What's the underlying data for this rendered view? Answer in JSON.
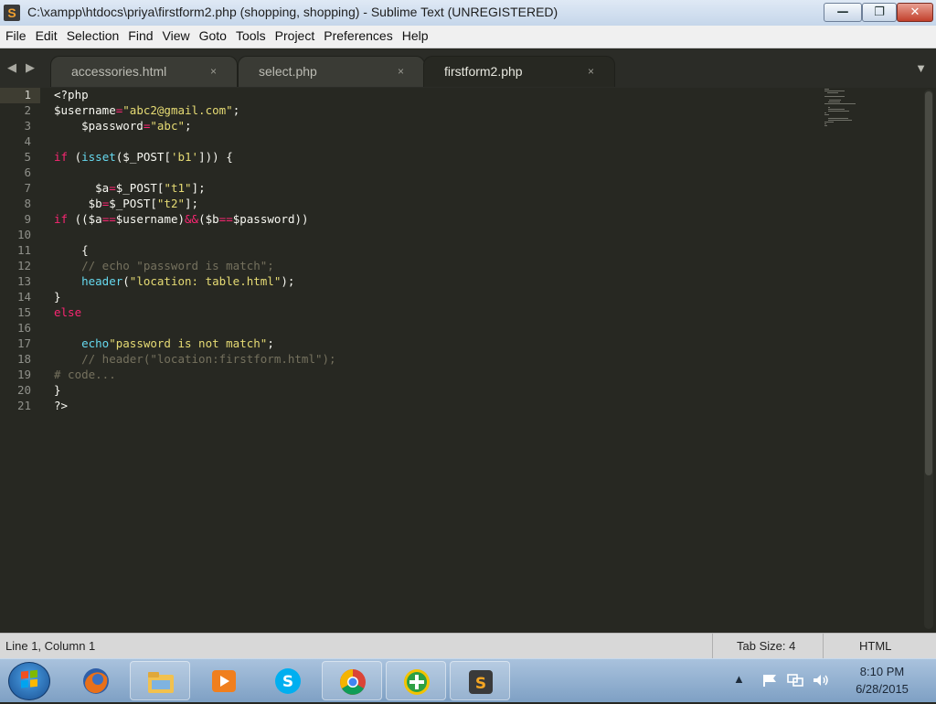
{
  "window": {
    "title": "C:\\xampp\\htdocs\\priya\\firstform2.php (shopping, shopping) - Sublime Text (UNREGISTERED)",
    "app_icon_letter": "S",
    "min_label": "—",
    "max_label": "❐",
    "close_label": "✕"
  },
  "menu": [
    "File",
    "Edit",
    "Selection",
    "Find",
    "View",
    "Goto",
    "Tools",
    "Project",
    "Preferences",
    "Help"
  ],
  "tabs": [
    {
      "label": "accessories.html",
      "close": "×",
      "active": false
    },
    {
      "label": "select.php",
      "close": "×",
      "active": false
    },
    {
      "label": "firstform2.php",
      "close": "×",
      "active": true
    }
  ],
  "nav": {
    "back": "◀",
    "forward": "▶",
    "dropdown": "▼"
  },
  "editor": {
    "current_line": 1,
    "lines": [
      [
        {
          "t": "<?php"
        }
      ],
      [
        {
          "t": "$username"
        },
        {
          "t": "=",
          "c": "o"
        },
        {
          "t": "\"abc2@gmail.com\"",
          "c": "s"
        },
        {
          "t": ";"
        }
      ],
      [
        {
          "t": "    $password"
        },
        {
          "t": "=",
          "c": "o"
        },
        {
          "t": "\"abc\"",
          "c": "s"
        },
        {
          "t": ";"
        }
      ],
      [
        {
          "t": ""
        }
      ],
      [
        {
          "t": "if",
          "c": "k"
        },
        {
          "t": " ("
        },
        {
          "t": "isset",
          "c": "f"
        },
        {
          "t": "($_POST["
        },
        {
          "t": "'b1'",
          "c": "s"
        },
        {
          "t": "])) {"
        }
      ],
      [
        {
          "t": ""
        }
      ],
      [
        {
          "t": "      $a"
        },
        {
          "t": "=",
          "c": "o"
        },
        {
          "t": "$_POST["
        },
        {
          "t": "\"t1\"",
          "c": "s"
        },
        {
          "t": "];"
        }
      ],
      [
        {
          "t": "     $b"
        },
        {
          "t": "=",
          "c": "o"
        },
        {
          "t": "$_POST["
        },
        {
          "t": "\"t2\"",
          "c": "s"
        },
        {
          "t": "];"
        }
      ],
      [
        {
          "t": "if",
          "c": "k"
        },
        {
          "t": " (($a"
        },
        {
          "t": "==",
          "c": "o"
        },
        {
          "t": "$username)"
        },
        {
          "t": "&&",
          "c": "o"
        },
        {
          "t": "($b"
        },
        {
          "t": "==",
          "c": "o"
        },
        {
          "t": "$password))"
        }
      ],
      [
        {
          "t": ""
        }
      ],
      [
        {
          "t": "    {"
        }
      ],
      [
        {
          "t": "    // echo \"password is match\";",
          "c": "c"
        }
      ],
      [
        {
          "t": "    "
        },
        {
          "t": "header",
          "c": "f"
        },
        {
          "t": "("
        },
        {
          "t": "\"location: table.html\"",
          "c": "s"
        },
        {
          "t": ");"
        }
      ],
      [
        {
          "t": "}"
        }
      ],
      [
        {
          "t": "else",
          "c": "k"
        }
      ],
      [
        {
          "t": ""
        }
      ],
      [
        {
          "t": "    "
        },
        {
          "t": "echo",
          "c": "f"
        },
        {
          "t": "\"password is not match\"",
          "c": "s"
        },
        {
          "t": ";"
        }
      ],
      [
        {
          "t": "    // header(\"location:firstform.html\");",
          "c": "c"
        }
      ],
      [
        {
          "t": "# code...",
          "c": "c"
        }
      ],
      [
        {
          "t": "}"
        }
      ],
      [
        {
          "t": "?>"
        }
      ]
    ]
  },
  "status": {
    "position": "Line 1, Column 1",
    "tab_size": "Tab Size: 4",
    "syntax": "HTML"
  },
  "taskbar": {
    "apps": [
      "firefox",
      "file-explorer",
      "media-player",
      "skype",
      "chrome",
      "green-plus-app",
      "sublime-text"
    ],
    "time": "8:10 PM",
    "date": "6/28/2015",
    "tray_arrow": "▲"
  }
}
